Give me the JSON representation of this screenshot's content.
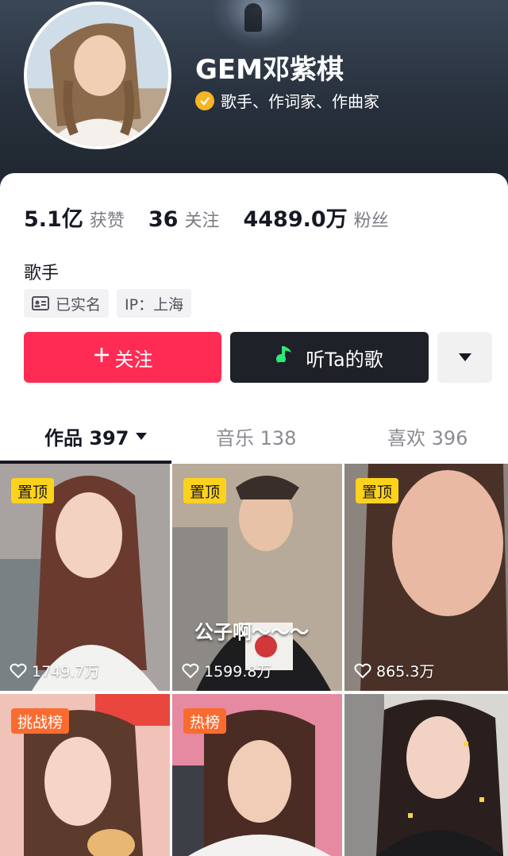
{
  "profile": {
    "name": "GEM邓紫棋",
    "verified_text": "歌手、作词家、作曲家",
    "bio": "歌手"
  },
  "stats": [
    {
      "value": "5.1亿",
      "label": "获赞"
    },
    {
      "value": "36",
      "label": "关注"
    },
    {
      "value": "4489.0万",
      "label": "粉丝"
    }
  ],
  "tags": {
    "realname": "已实名",
    "ip": "IP：上海"
  },
  "buttons": {
    "follow": "关注",
    "listen": "听Ta的歌"
  },
  "tabs": {
    "works": "作品 397",
    "music": "音乐 138",
    "likes": "喜欢 396"
  },
  "videos": [
    {
      "badge": "置顶",
      "likes": "1749.7万"
    },
    {
      "badge": "置顶",
      "likes": "1599.8万",
      "overlay": "公子啊～～～"
    },
    {
      "badge": "置顶",
      "likes": "865.3万"
    },
    {
      "badge": "挑战榜"
    },
    {
      "badge": "热榜"
    },
    {}
  ],
  "colors": {
    "accent": "#fe2c55",
    "dark_button": "#1f2129",
    "verify": "#f8b425",
    "pin_yellow": "#fcd21c",
    "pin_orange": "#fb6b2f"
  }
}
